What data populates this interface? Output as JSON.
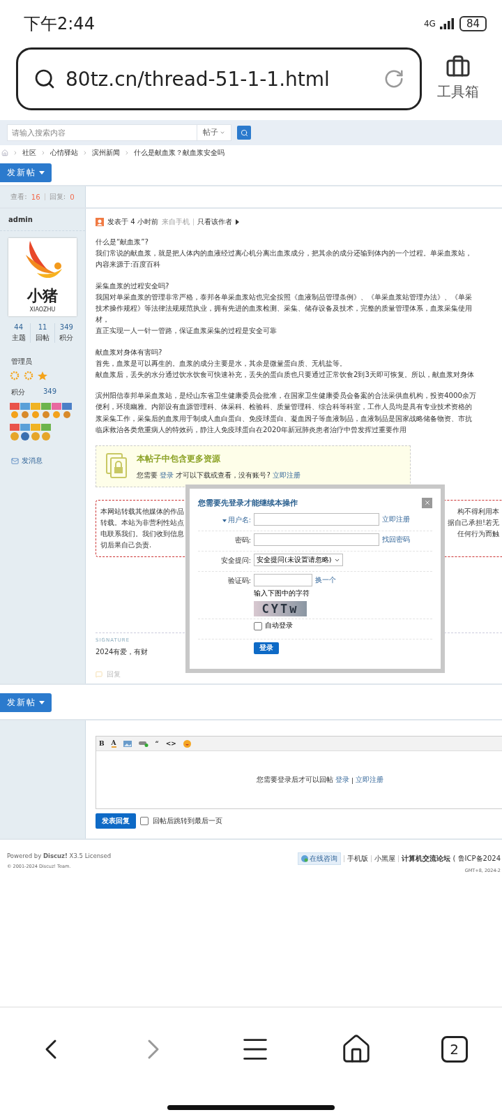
{
  "status_bar": {
    "time": "下午2:44",
    "network": "4G",
    "battery": "84"
  },
  "address_bar": {
    "url": "80tz.cn/thread-51-1-1.html",
    "toolbox_label": "工具箱"
  },
  "search": {
    "placeholder": "请输入搜索内容",
    "scope": "帖子"
  },
  "breadcrumb": [
    "社区",
    "心情驿站",
    "滨州新闻",
    "什么是献血浆？献血浆安全吗"
  ],
  "new_thread_button": "发新帖",
  "new_thread_button_bottom": "发新帖",
  "thread_stats": {
    "views_label": "查看:",
    "views": "16",
    "replies_label": "回复:",
    "replies": "0"
  },
  "author": {
    "name": "admin",
    "logo_text": "小猪",
    "logo_subtext": "XIAOZHU",
    "stats": [
      {
        "value": "44",
        "label": "主题"
      },
      {
        "value": "11",
        "label": "回帖"
      },
      {
        "value": "349",
        "label": "积分"
      }
    ],
    "group": "管理员",
    "points_label": "积分",
    "points": "349",
    "message_link": "发消息"
  },
  "post": {
    "posted": "发表于 4 小时前",
    "source": "来自手机",
    "author_only": "只看该作者",
    "paragraphs": [
      [
        "什么是“献血浆”?",
        "我们常说的献血浆，就是把人体内的血液经过离心机分离出血浆成分，把其余的成分还输到体内的一个过程。单采血浆站，",
        "内容来源于:百度百科"
      ],
      [
        "采集血浆的过程安全吗?",
        "我国对单采血浆的管理非常严格，泰邦各单采血浆站也完全按照《血液制品管理条例》、《单采血浆站管理办法》、《单采",
        "技术操作规程》等法律法规规范执业，拥有先进的血浆检测、采集、储存设备及技术，完整的质量管理体系，血浆采集使用",
        "材，",
        "直正实现一人一针一管路，保证血浆采集的过程是安全可靠"
      ],
      [
        "献血浆对身体有害吗?",
        "首先，血浆是可以再生的。血浆的成分主要是水，其余是微量蛋白质、无机盐等。",
        "献血浆后，丢失的水分通过饮水饮食可快速补充，丢失的蛋白质也只要通过正常饮食2到3天即可恢复。所以，献血浆对身体"
      ],
      [
        "滨州阳信泰邦单采血浆站，是经山东省卫生健康委员会批准，在国家卫生健康委员会备案的合法采供血机构，投资4000余万",
        "便利，环境幽雅。内部设有血源管理科、体采科、检验科、质量管理科、综合科等科室，工作人员均是具有专业技术资格的",
        "浆采集工作，采集后的血浆用于制成人血白蛋白、免疫球蛋白、凝血因子等血液制品，血液制品是国家战略储备物资、市抗",
        "临床救治各类危重病人的特效药，静注人免疫球蛋白在2020年新冠肺炎患者治疗中曾发挥过重要作用"
      ]
    ]
  },
  "resource_box": {
    "title": "本帖子中包含更多资源",
    "text_before": "您需要",
    "login": "登录",
    "text_middle": "才可以下载或查看，没有账号?",
    "register": "立即注册"
  },
  "disclaimer": [
    {
      "left": "本网站转载其他媒体的作品",
      "right": "构不得利用本"
    },
    {
      "left": "转载。本站为非营利性站点",
      "right": "据自己承担!若无"
    },
    {
      "left": "电联系我们。我们收到信息",
      "right": "任何行为而触"
    },
    {
      "left": "切后果自己负责."
    }
  ],
  "signature": {
    "label": "SIGNATURE",
    "text": "2024有爱，有财"
  },
  "reply_link": "回复",
  "login_dialog": {
    "title": "您需要先登录才能继续本操作",
    "fields": [
      {
        "kind": "text",
        "label": "用户名:",
        "link": "立即注册"
      },
      {
        "kind": "password",
        "label": "密码:",
        "link": "找回密码"
      },
      {
        "kind": "select",
        "label": "安全提问:",
        "value": "安全提问(未设置请忽略)"
      },
      {
        "kind": "captcha",
        "label": "验证码:",
        "link": "换一个",
        "hint": "输入下图中的字符",
        "code": "CYTw"
      }
    ],
    "remember": {
      "label": "自动登录",
      "checked": false
    },
    "submit": "登录"
  },
  "editor": {
    "toolbar": [
      {
        "kind": "bold",
        "glyph": "B"
      },
      {
        "kind": "color",
        "glyph": "A"
      },
      {
        "kind": "image"
      },
      {
        "kind": "link"
      },
      {
        "kind": "quote",
        "glyph": "“"
      },
      {
        "kind": "code",
        "glyph": "<>"
      },
      {
        "kind": "smiley"
      }
    ],
    "notice": "您需要登录后才可以回帖",
    "login": "登录",
    "separator": "|",
    "register": "立即注册",
    "submit": "发表回复",
    "jump_option": {
      "label": "回帖后跳转到最后一页",
      "checked": false
    }
  },
  "footer": {
    "powered": "Powered by **Discuz!** X3.5 Licensed",
    "copyright": "© 2001-2024 Discuz! Team.",
    "consult": "在线咨询",
    "links": [
      "手机版",
      "小黑屋"
    ],
    "site": "计算机交流论坛",
    "icp": "( 鲁ICP备2024",
    "time": "GMT+8, 2024-2"
  },
  "bottom_nav": {
    "tabs_count": "2"
  }
}
